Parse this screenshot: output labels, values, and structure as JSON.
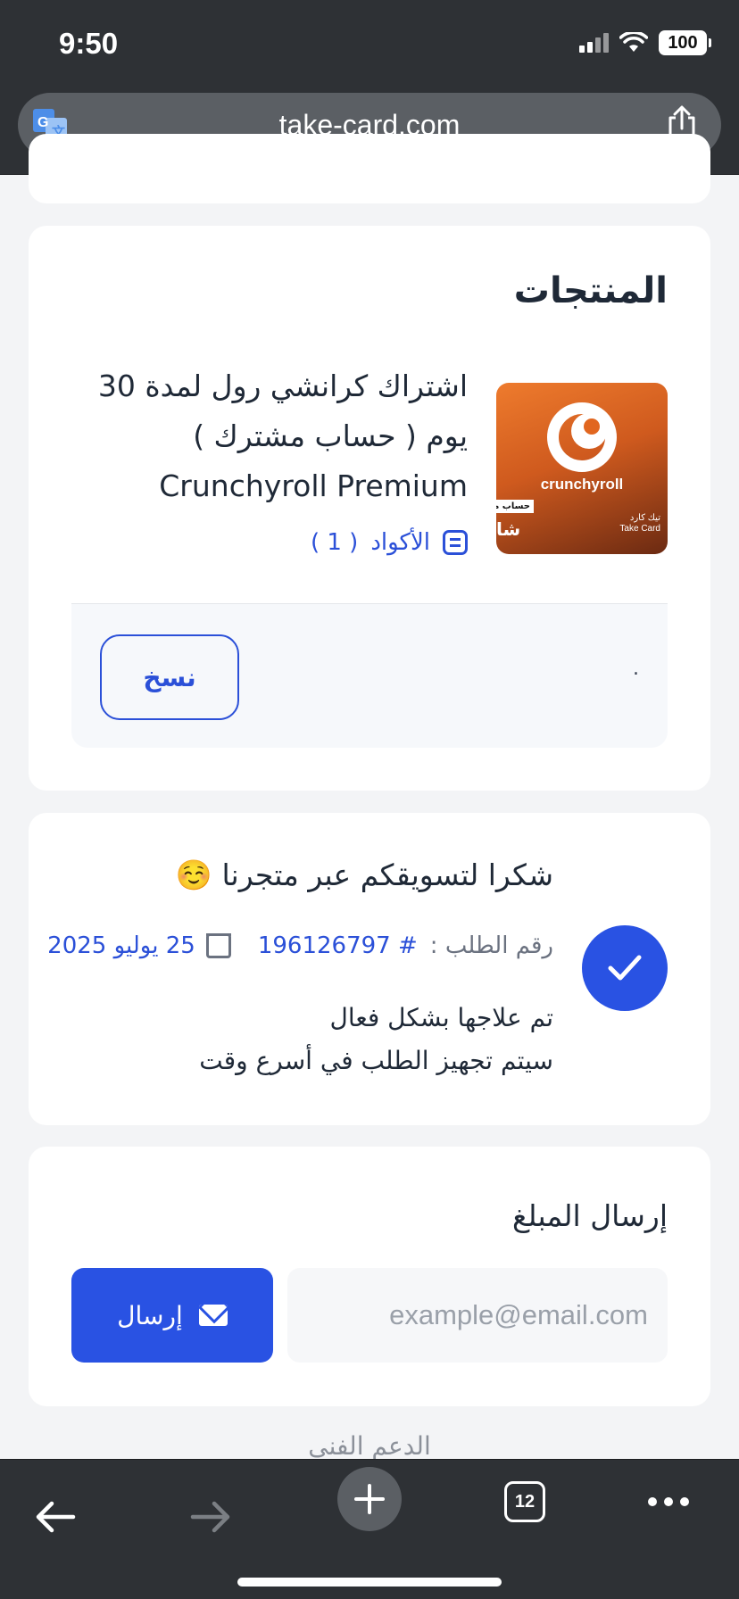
{
  "status_bar": {
    "time": "9:50",
    "battery": "100"
  },
  "browser": {
    "url": "take-card.com",
    "tab_count": "12"
  },
  "products": {
    "title": "المنتجات",
    "product_name_ar": "اشتراك كرانشي رول لمدة 30 يوم ( حساب مشترك )",
    "product_name_en": "Crunchyroll Premium",
    "codes_label": "الأكواد",
    "codes_count": "( 1 )",
    "code_value": ".",
    "copy_label": "نسخ",
    "image": {
      "brand": "crunchyroll",
      "tag": "حساب مشترك",
      "ar_text": "شا",
      "store_ar": "تيك كارد",
      "store_en": "Take Card"
    }
  },
  "order": {
    "thanks_text": "شكرا لتسويقكم عبر متجرنا ☺️",
    "order_label": "رقم الطلب :",
    "order_number": "# 196126797",
    "date": "25 يوليو 2025",
    "status_line1": "تم علاجها بشكل فعال",
    "status_line2": "سيتم تجهيز الطلب في أسرع وقت"
  },
  "send": {
    "title": "إرسال المبلغ",
    "email_placeholder": "example@email.com",
    "button_label": "إرسال"
  },
  "support": {
    "label": "الدعم الفني"
  },
  "colors": {
    "accent": "#2952e3",
    "link": "#2b50d8",
    "chrome": "#2e3135"
  }
}
